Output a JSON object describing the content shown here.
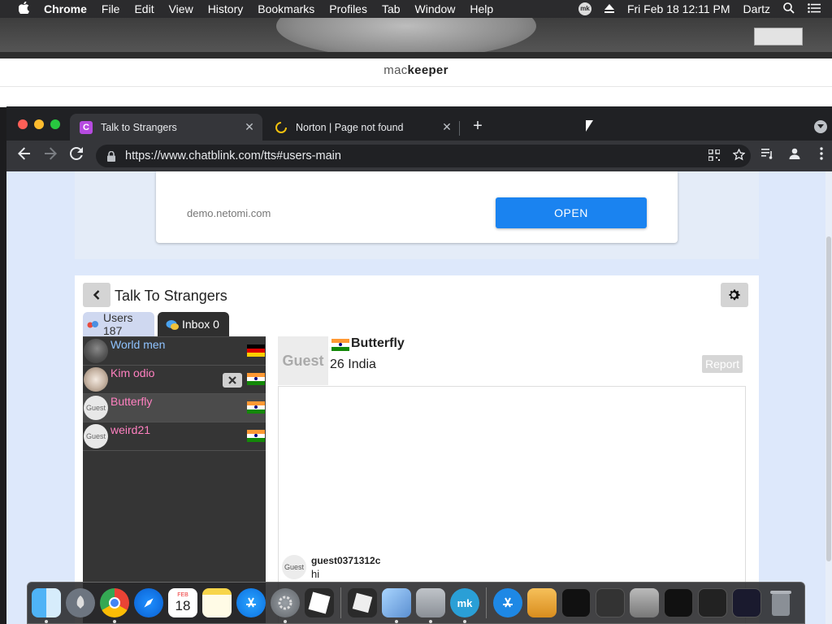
{
  "menubar": {
    "app": "Chrome",
    "items": [
      "File",
      "Edit",
      "View",
      "History",
      "Bookmarks",
      "Profiles",
      "Tab",
      "Window",
      "Help"
    ],
    "clock": "Fri Feb 18  12:11 PM",
    "user": "Dartz",
    "mk_label": "mk"
  },
  "background_window": {
    "logo_light": "mac",
    "logo_bold": "keeper"
  },
  "browser": {
    "tabs": [
      {
        "title": "Talk to Strangers",
        "favicon": "c-letter-icon",
        "favicon_letter": "C",
        "active": true
      },
      {
        "title": "Norton | Page not found",
        "favicon": "loading-spinner-icon",
        "active": false
      }
    ],
    "url": "https://www.chatblink.com/tts#users-main",
    "close_glyph": "✕",
    "new_tab_glyph": "+"
  },
  "ad": {
    "domain": "demo.netomi.com",
    "button": "OPEN"
  },
  "chat": {
    "title": "Talk To Strangers",
    "tabs": {
      "users": "Users 187",
      "inbox": "Inbox 0"
    },
    "users": [
      {
        "name": "World men",
        "name_color": "#8fc3ff",
        "flag": "de",
        "avatar": "photo"
      },
      {
        "name": "Kim odio",
        "name_color": "#ff80c0",
        "flag": "in",
        "avatar": "photo",
        "removable": true
      },
      {
        "name": "Butterfly",
        "name_color": "#ff80c0",
        "flag": "in",
        "avatar": "guest",
        "selected": true
      },
      {
        "name": "weird21",
        "name_color": "#ff80c0",
        "flag": "in",
        "avatar": "guest"
      }
    ],
    "guest_label": "Guest",
    "profile": {
      "name": "Butterfly",
      "meta": "26 India",
      "avatar_label": "Guest",
      "report": "Report"
    },
    "messages": [
      {
        "user": "guest0371312c",
        "text": "hi",
        "avatar_label": "Guest"
      }
    ]
  },
  "dock": {
    "icons": [
      "finder-icon",
      "launchpad-icon",
      "chrome-icon",
      "safari-icon",
      "calendar-icon",
      "notes-icon",
      "app-store-icon",
      "system-preferences-icon",
      "roblox-icon",
      "roblox-studio-icon",
      "preview-icon",
      "installer-icon",
      "mackeeper-icon",
      "app-store-download-icon",
      "package-icon",
      "window-thumb-1-icon",
      "window-thumb-2-icon",
      "window-thumb-3-icon",
      "window-thumb-4-icon",
      "window-thumb-5-icon",
      "window-thumb-6-icon",
      "trash-icon"
    ],
    "calendar_month": "FEB",
    "calendar_day": "18"
  },
  "colors": {
    "accent_blue": "#1a83f0",
    "user_name_blue": "#8fc3ff",
    "user_name_pink": "#ff80c0",
    "chrome_dark": "#202124",
    "page_bg": "#dde8fb"
  }
}
